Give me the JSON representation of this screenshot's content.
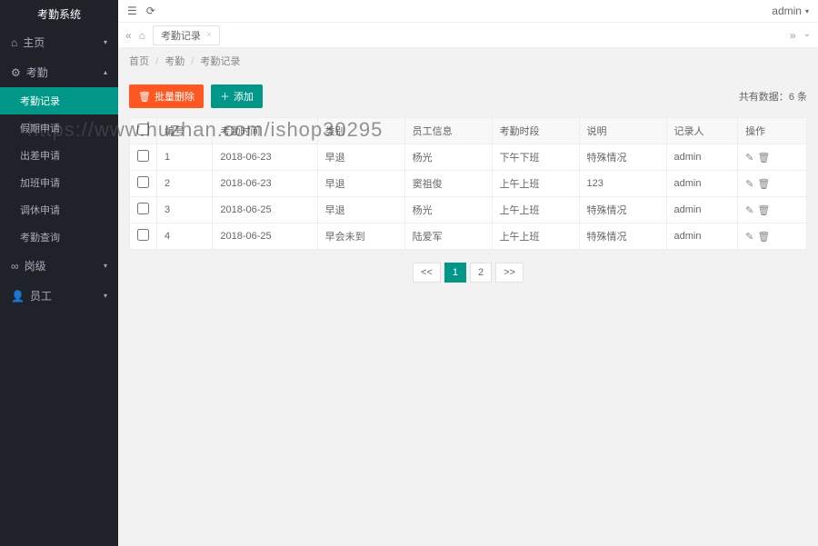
{
  "app": {
    "title": "考勤系统"
  },
  "user": {
    "name": "admin"
  },
  "sidebar": {
    "items": [
      {
        "icon": "home-icon",
        "label": "主页",
        "expandable": true
      },
      {
        "icon": "gear-icon",
        "label": "考勤",
        "expandable": true,
        "expanded": true,
        "children": [
          {
            "label": "考勤记录",
            "active": true
          },
          {
            "label": "假期申请"
          },
          {
            "label": "出差申请"
          },
          {
            "label": "加班申请"
          },
          {
            "label": "调休申请"
          },
          {
            "label": "考勤查询"
          }
        ]
      },
      {
        "icon": "link-icon",
        "label": "岗级",
        "expandable": true
      },
      {
        "icon": "user-icon",
        "label": "员工",
        "expandable": true
      }
    ]
  },
  "tabs": {
    "home_icon": "⌂",
    "items": [
      {
        "label": "考勤记录"
      }
    ]
  },
  "breadcrumb": [
    "首页",
    "考勤",
    "考勤记录"
  ],
  "actions": {
    "batch_delete": "批量删除",
    "add": "添加"
  },
  "summary": {
    "prefix": "共有数据：",
    "count": "6",
    "suffix": " 条"
  },
  "table": {
    "headers": [
      "",
      "编号",
      "考勤时间",
      "类别",
      "员工信息",
      "考勤时段",
      "说明",
      "记录人",
      "操作"
    ],
    "rows": [
      {
        "no": "1",
        "date": "2018-06-23",
        "type": "早退",
        "emp": "杨光",
        "period": "下午下班",
        "note": "特殊情况",
        "rec": "admin"
      },
      {
        "no": "2",
        "date": "2018-06-23",
        "type": "早退",
        "emp": "窦祖俊",
        "period": "上午上班",
        "note": "123",
        "rec": "admin"
      },
      {
        "no": "3",
        "date": "2018-06-25",
        "type": "早退",
        "emp": "杨光",
        "period": "上午上班",
        "note": "特殊情况",
        "rec": "admin"
      },
      {
        "no": "4",
        "date": "2018-06-25",
        "type": "早会未到",
        "emp": "陆爱军",
        "period": "上午上班",
        "note": "特殊情况",
        "rec": "admin"
      }
    ]
  },
  "pager": {
    "prev": "<<",
    "next": ">>",
    "pages": [
      "1",
      "2"
    ],
    "current": "1"
  },
  "watermark": "https://www.huzhan.com/ishop30295"
}
